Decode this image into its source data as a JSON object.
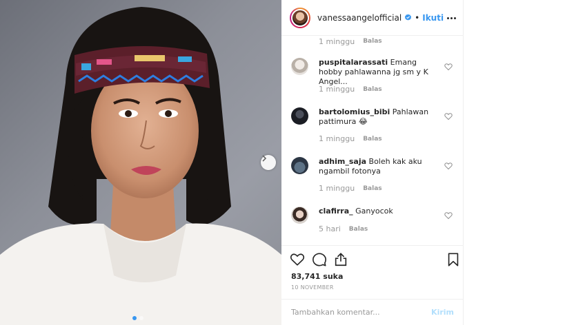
{
  "post": {
    "username": "vanessaangelofficial",
    "separator": "•",
    "follow_label": "Ikuti",
    "verified": true,
    "image_count": 2,
    "current_image": 1
  },
  "first_meta": {
    "time": "1 minggu",
    "reply": "Balas"
  },
  "comments": [
    {
      "user": "puspitalarassati",
      "text": "Emang hobby pahlawanna jg sm y K Angel...",
      "time": "1 minggu",
      "reply": "Balas"
    },
    {
      "user": "bartolomius_bibi",
      "text": "Pahlawan pattimura 😂",
      "time": "1 minggu",
      "reply": "Balas"
    },
    {
      "user": "adhim_saja",
      "text": "Boleh kak aku ngambil fotonya",
      "time": "1 minggu",
      "reply": "Balas"
    },
    {
      "user": "clafirra_",
      "text": "Ganyocok",
      "time": "5 hari",
      "reply": "Balas"
    }
  ],
  "likes": "83,741 suka",
  "date": "10 NOVEMBER",
  "composer": {
    "placeholder": "Tambahkan komentar...",
    "post_label": "Kirim"
  },
  "colors": {
    "accent": "#3897f0",
    "post_disabled": "#b2dffc",
    "muted": "#999999",
    "divider": "#efefef"
  },
  "icons": [
    "next-arrow-icon",
    "verified-icon",
    "more-options-icon",
    "heart-icon",
    "comment-icon",
    "share-icon",
    "bookmark-icon"
  ]
}
